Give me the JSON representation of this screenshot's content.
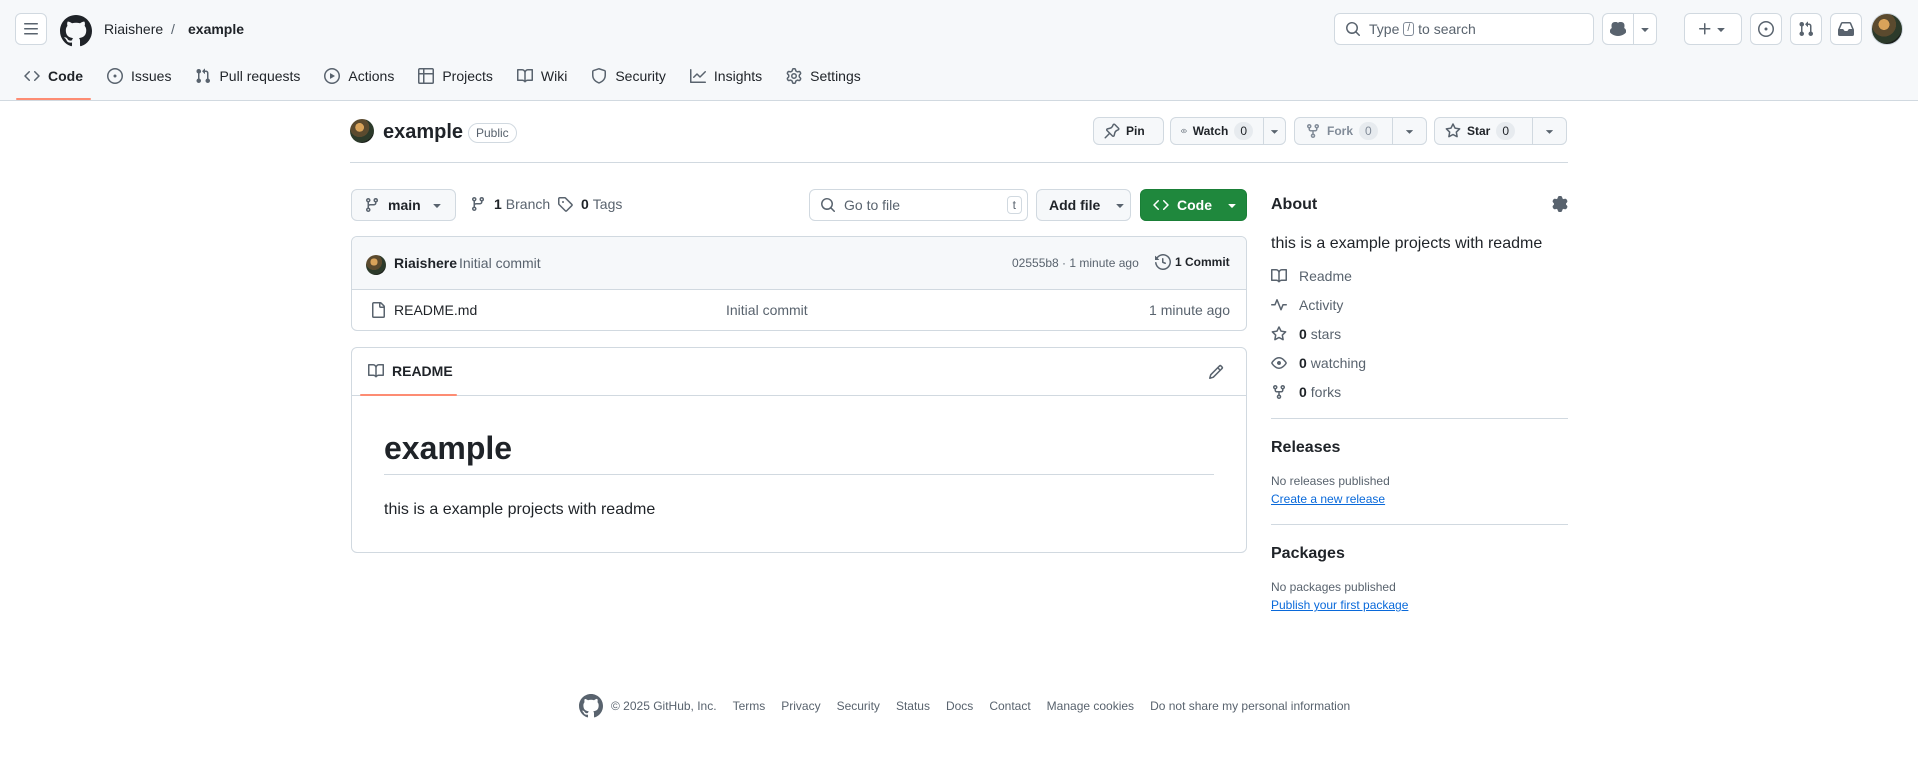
{
  "header": {
    "breadcrumb_owner": "Riaishere",
    "breadcrumb_sep": "/",
    "breadcrumb_repo": "example",
    "search_prefix": "Type",
    "search_key": "/",
    "search_suffix": "to search"
  },
  "tabs": [
    {
      "label": "Code",
      "icon": "code-icon"
    },
    {
      "label": "Issues",
      "icon": "issue-icon"
    },
    {
      "label": "Pull requests",
      "icon": "pull-request-icon"
    },
    {
      "label": "Actions",
      "icon": "play-icon"
    },
    {
      "label": "Projects",
      "icon": "table-icon"
    },
    {
      "label": "Wiki",
      "icon": "book-icon"
    },
    {
      "label": "Security",
      "icon": "shield-icon"
    },
    {
      "label": "Insights",
      "icon": "graph-icon"
    },
    {
      "label": "Settings",
      "icon": "gear-icon"
    }
  ],
  "repo": {
    "name": "example",
    "visibility": "Public",
    "pin_label": "Pin",
    "watch_label": "Watch",
    "watch_count": "0",
    "fork_label": "Fork",
    "fork_count": "0",
    "star_label": "Star",
    "star_count": "0"
  },
  "toolbar": {
    "branch": "main",
    "branch_count": "1",
    "branch_label": "Branch",
    "tag_count": "0",
    "tag_label": "Tags",
    "goto_placeholder": "Go to file",
    "goto_key": "t",
    "add_file_label": "Add file",
    "code_label": "Code"
  },
  "commit": {
    "author": "Riaishere",
    "message": "Initial commit",
    "hash_time": "02555b8 · 1 minute ago",
    "count_label": "1 Commit"
  },
  "files": [
    {
      "name": "README.md",
      "commit": "Initial commit",
      "time": "1 minute ago"
    }
  ],
  "readme": {
    "tab_label": "README",
    "heading": "example",
    "body": "this is a example projects with readme"
  },
  "about": {
    "title": "About",
    "description": "this is a example projects with readme",
    "readme_label": "Readme",
    "activity_label": "Activity",
    "stars_count": "0",
    "stars_label": "stars",
    "watching_count": "0",
    "watching_label": "watching",
    "forks_count": "0",
    "forks_label": "forks"
  },
  "releases": {
    "title": "Releases",
    "empty_text": "No releases published",
    "link": "Create a new release"
  },
  "packages": {
    "title": "Packages",
    "empty_text": "No packages published",
    "link": "Publish your first package"
  },
  "footer": {
    "copyright": "© 2025 GitHub, Inc.",
    "links": [
      "Terms",
      "Privacy",
      "Security",
      "Status",
      "Docs",
      "Contact",
      "Manage cookies",
      "Do not share my personal information"
    ]
  },
  "colors": {
    "accent_green": "#1f883d",
    "tab_underline": "#fd8c73",
    "link_blue": "#0969da"
  }
}
